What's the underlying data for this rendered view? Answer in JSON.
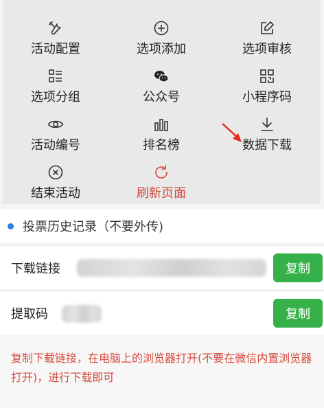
{
  "menu": {
    "items": [
      {
        "label": "活动配置",
        "icon": "tools-icon"
      },
      {
        "label": "选项添加",
        "icon": "plus-circle-icon"
      },
      {
        "label": "选项审核",
        "icon": "edit-square-icon"
      },
      {
        "label": "选项分组",
        "icon": "list-group-icon"
      },
      {
        "label": "公众号",
        "icon": "wechat-icon"
      },
      {
        "label": "小程序码",
        "icon": "qrcode-icon"
      },
      {
        "label": "活动编号",
        "icon": "eye-icon"
      },
      {
        "label": "排名榜",
        "icon": "bar-rank-icon"
      },
      {
        "label": "数据下载",
        "icon": "download-icon"
      },
      {
        "label": "结束活动",
        "icon": "close-circle-icon"
      },
      {
        "label": "刷新页面",
        "icon": "refresh-icon"
      }
    ]
  },
  "history": {
    "label": "投票历史记录（不要外传)"
  },
  "download_link": {
    "label": "下载链接",
    "copy_label": "复制"
  },
  "extract_code": {
    "label": "提取码",
    "copy_label": "复制"
  },
  "note": {
    "text": "复制下载链接，在电脑上的浏览器打开(不要在微信内置浏览器打开)，进行下载即可"
  },
  "colors": {
    "accent_green": "#36b149",
    "alert_red": "#d6453a",
    "dot_blue": "#2a7de1"
  }
}
